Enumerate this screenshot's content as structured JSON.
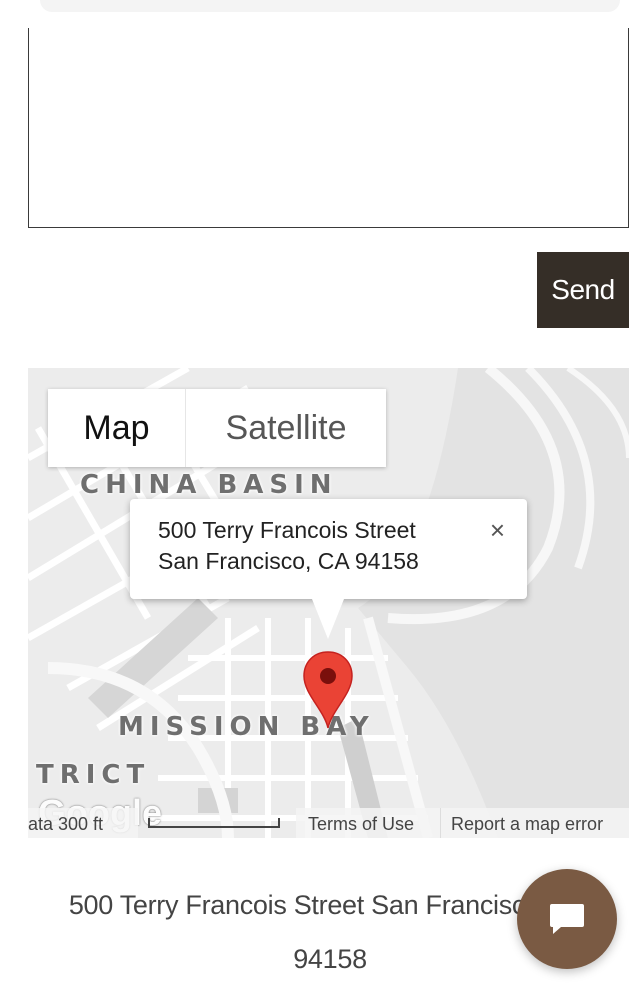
{
  "form": {
    "send_label": "Send"
  },
  "map": {
    "type_control": {
      "map_label": "Map",
      "satellite_label": "Satellite"
    },
    "area_labels": {
      "china_basin": "CHINA BASIN",
      "mission_bay": "MISSION BAY",
      "district_fragment": "TRICT"
    },
    "info_window": {
      "line1": "500 Terry Francois Street",
      "line2": "San Francisco, CA 94158",
      "close_glyph": "×"
    },
    "google_logo": "Google",
    "footer": {
      "map_data_fragment": "ata  300 ft",
      "terms": "Terms of Use",
      "report": "Report a map error"
    },
    "marker_color": "#ea4335",
    "land_color": "#ececec",
    "road_color": "#ffffff"
  },
  "address": {
    "line1": "500 Terry Francois Street San Francisco, CA",
    "line2": "94158"
  },
  "colors": {
    "send_bg": "#352e27",
    "chat_bg": "#7a5a43"
  },
  "icons": {
    "close": "close-icon",
    "marker": "map-pin-icon",
    "chat": "chat-bubble-icon"
  }
}
